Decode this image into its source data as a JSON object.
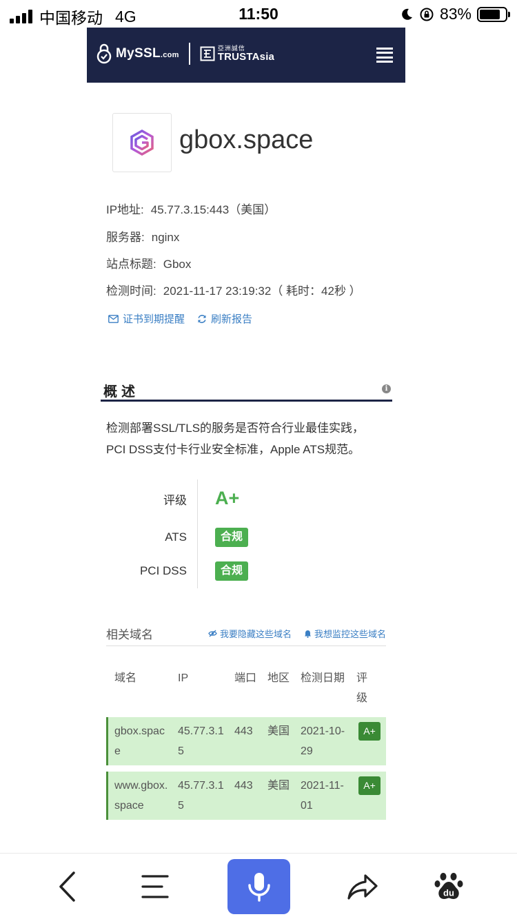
{
  "status_bar": {
    "carrier": "中国移动",
    "network": "4G",
    "time": "11:50",
    "battery": "83%"
  },
  "header": {
    "brand_main": "MySSL",
    "brand_suffix": ".com",
    "partner_cn": "亞洲誠信",
    "partner_en": "TRUSTAsia",
    "menu_icon": "hamburger-menu-icon",
    "bg_color": "#1c2446"
  },
  "site": {
    "domain": "gbox.space",
    "ip_label": "IP地址:",
    "ip_value": "45.77.3.15:443（美国）",
    "server_label": "服务器:",
    "server_value": "nginx",
    "title_label": "站点标题:",
    "title_value": "Gbox",
    "time_label": "检测时间:",
    "time_value": "2021-11-17 23:19:32（ 耗时：42秒 ）",
    "remind_link": "证书到期提醒",
    "refresh_link": "刷新报告"
  },
  "overview": {
    "title": "概述",
    "desc_line1": "检测部署SSL/TLS的服务是否符合行业最佳实践，",
    "desc_line2": "PCI DSS支付卡行业安全标准，Apple ATS规范。",
    "grade_label": "评级",
    "grade_value": "A+",
    "ats_label": "ATS",
    "ats_value": "合规",
    "pci_label": "PCI DSS",
    "pci_value": "合规",
    "accent_color": "#4caf50"
  },
  "related": {
    "title": "相关域名",
    "hide_link": "我要隐藏这些域名",
    "monitor_link": "我想监控这些域名",
    "columns": {
      "domain": "域名",
      "ip": "IP",
      "port": "端口",
      "region": "地区",
      "date_line1": "检测日期",
      "grade_line1": "评",
      "grade_line2": "级"
    },
    "rows": [
      {
        "domain_l1": "gbox.spac",
        "domain_l2": "e",
        "ip_l1": "45.77.3.1",
        "ip_l2": "5",
        "port": "443",
        "region": "美国",
        "date_l1": "2021-10-",
        "date_l2": "29",
        "grade": "A+"
      },
      {
        "domain_l1": "www.gbox.",
        "domain_l2": "space",
        "ip_l1": "45.77.3.1",
        "ip_l2": "5",
        "port": "443",
        "region": "美国",
        "date_l1": "2021-11-",
        "date_l2": "01",
        "grade": "A+"
      }
    ]
  },
  "toolbar": {
    "icons": [
      "back-icon",
      "menu-lines-icon",
      "microphone-icon",
      "share-icon",
      "baidu-paw-icon"
    ],
    "mic_color": "#4e6ee6",
    "baidu_text": "du"
  }
}
